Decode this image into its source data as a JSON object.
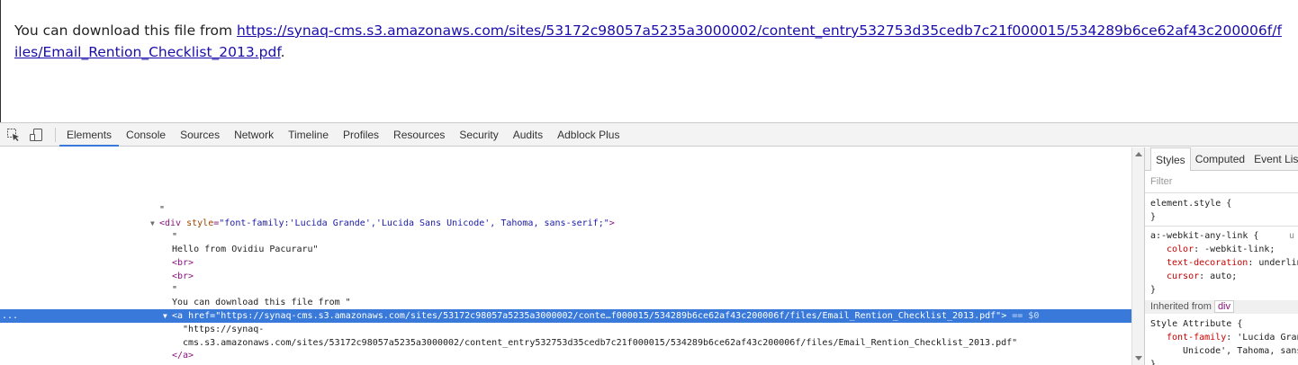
{
  "page": {
    "text_before": "You can download this file from ",
    "link_text": "https://synaq-cms.s3.amazonaws.com/sites/53172c98057a5235a3000002/content_entry532753d35cedb7c21f000015/534289b6ce62af43c200006f/files/Email_Rention_Checklist_2013.pdf",
    "text_after": "."
  },
  "devtools": {
    "icons": [
      "inspect-icon",
      "device-mode-icon"
    ],
    "tabs": [
      "Elements",
      "Console",
      "Sources",
      "Network",
      "Timeline",
      "Profiles",
      "Resources",
      "Security",
      "Audits",
      "Adblock Plus"
    ],
    "active_tab": "Elements",
    "dom": {
      "text_quote": "\"",
      "div_open_tag": "<div",
      "div_attr_name": "style",
      "div_attr_value": "\"font-family:'Lucida Grande','Lucida Sans Unicode', Tahoma, sans-serif;\"",
      "div_close_bracket": ">",
      "quote_line": "\"",
      "hello_text": "Hello from Ovidiu Pacuraru\"",
      "br1": "<br>",
      "br2": "<br>",
      "quote_line2": "\"",
      "download_text": "You can download this file from \"",
      "a_open_tag": "<a",
      "a_attr_name": "href",
      "a_attr_value": "\"https://synaq-cms.s3.amazonaws.com/sites/53172c98057a5235a3000002/conte…f000015/534289b6ce62af43c200006f/files/Email_Rention_Checklist_2013.pdf\"",
      "a_close_bracket": ">",
      "eq_dollar": "== $0",
      "selected_dots": "...",
      "link_text_line1": "\"https://synaq-",
      "link_text_line2": "cms.s3.amazonaws.com/sites/53172c98057a5235a3000002/content_entry532753d35cedb7c21f000015/534289b6ce62af43c200006f/files/Email_Rention_Checklist_2013.pdf\"",
      "a_end_tag": "</a>"
    },
    "sidebar": {
      "tabs": [
        "Styles",
        "Computed",
        "Event Listeners"
      ],
      "active_tab": "Styles",
      "filter_placeholder": "Filter",
      "element_style": "element.style {",
      "close_brace": "}",
      "rule_selector": "a:-webkit-any-link {",
      "rule_source": "u",
      "props": [
        {
          "name": "color",
          "value": "-webkit-link;"
        },
        {
          "name": "text-decoration",
          "value": "underline;"
        },
        {
          "name": "cursor",
          "value": "auto;"
        }
      ],
      "close_brace2": "}",
      "inherited_label": "Inherited from",
      "inherited_tag": "div",
      "style_attribute": "Style Attribute {",
      "font_family_prop": "font-family",
      "font_family_value": "'Lucida Grande',",
      "font_family_value2": "Unicode', Tahoma, sans-serif;",
      "close_brace3": "}"
    }
  },
  "colors": {
    "selection": "#3879d9",
    "link": "#1a0dab",
    "tag": "#881280",
    "attr_name": "#994500",
    "attr_value": "#1a1aa6"
  }
}
